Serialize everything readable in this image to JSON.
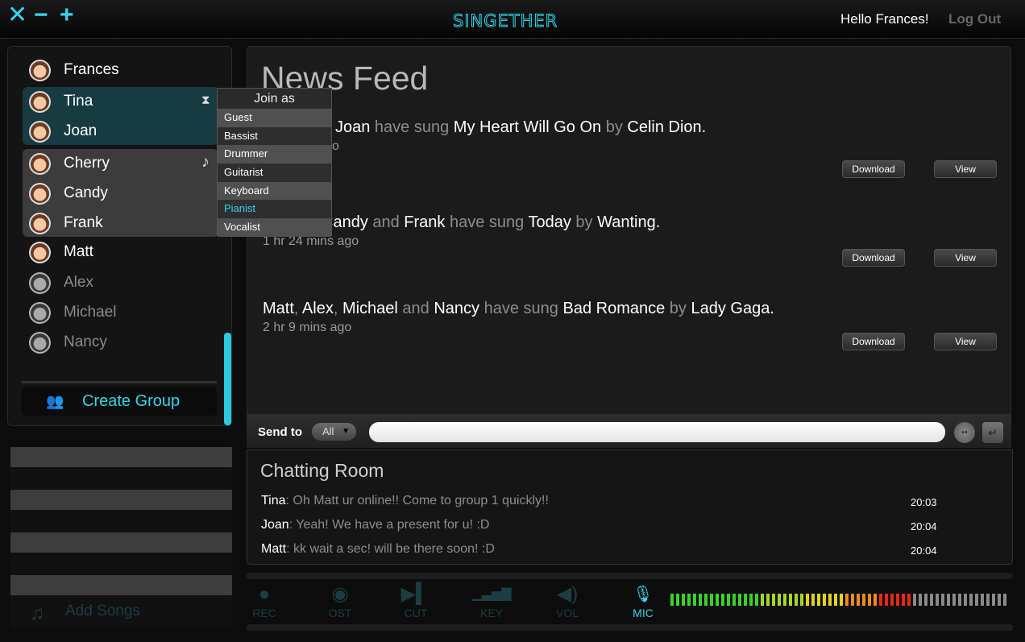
{
  "window": {
    "close_symbol": "✕",
    "minimize_symbol": "−",
    "maximize_symbol": "+",
    "logo_text": "SINGETHER",
    "greeting": "Hello Frances!",
    "logout": "Log Out",
    "accent_color": "#33d6ee"
  },
  "friends": {
    "list": [
      {
        "name": "Frances",
        "status": "online"
      },
      {
        "name": "Tina",
        "status": "online"
      },
      {
        "name": "Joan",
        "status": "online"
      },
      {
        "name": "Cherry",
        "status": "online"
      },
      {
        "name": "Candy",
        "status": "online"
      },
      {
        "name": "Frank",
        "status": "online"
      },
      {
        "name": "Matt",
        "status": "online"
      },
      {
        "name": "Alex",
        "status": "offline"
      },
      {
        "name": "Michael",
        "status": "offline"
      },
      {
        "name": "Nancy",
        "status": "offline"
      }
    ],
    "waiting_icon": "hourglass-icon",
    "singing_icon": "music-note-icon",
    "create_group": "Create Group"
  },
  "join_popup": {
    "title": "Join as",
    "options": [
      "Guest",
      "Bassist",
      "Drummer",
      "Guitarist",
      "Keyboard",
      "Pianist",
      "Vocalist"
    ],
    "highlighted": "Pianist"
  },
  "songs": {
    "add_label": "Add Songs"
  },
  "news_feed": {
    "title": "News Feed",
    "items": [
      {
        "segments": [
          {
            "t": "Joan",
            "c": "w"
          },
          {
            "t": " have sung ",
            "c": "g"
          },
          {
            "t": "My Heart Will Go On",
            "c": "w"
          },
          {
            "t": " by ",
            "c": "g"
          },
          {
            "t": "Celin Dion",
            "c": "w"
          },
          {
            "t": ".",
            "c": "w"
          }
        ],
        "time": "o",
        "download": "Download",
        "view": "View"
      },
      {
        "segments": [
          {
            "t": "Candy",
            "c": "w"
          },
          {
            "t": " and ",
            "c": "g"
          },
          {
            "t": "Frank",
            "c": "w"
          },
          {
            "t": " have sung ",
            "c": "g"
          },
          {
            "t": "Today",
            "c": "w"
          },
          {
            "t": " by ",
            "c": "g"
          },
          {
            "t": "Wanting",
            "c": "w"
          },
          {
            "t": ".",
            "c": "w"
          }
        ],
        "time": "1 hr 24 mins ago",
        "download": "Download",
        "view": "View"
      },
      {
        "segments": [
          {
            "t": "Matt",
            "c": "w"
          },
          {
            "t": ", ",
            "c": "g"
          },
          {
            "t": "Alex",
            "c": "w"
          },
          {
            "t": ", ",
            "c": "g"
          },
          {
            "t": "Michael",
            "c": "w"
          },
          {
            "t": " and ",
            "c": "g"
          },
          {
            "t": "Nancy",
            "c": "w"
          },
          {
            "t": " have sung ",
            "c": "g"
          },
          {
            "t": "Bad Romance",
            "c": "w"
          },
          {
            "t": " by ",
            "c": "g"
          },
          {
            "t": "Lady Gaga",
            "c": "w"
          },
          {
            "t": ".",
            "c": "w"
          }
        ],
        "time": "2 hr 9 mins ago",
        "download": "Download",
        "view": "View"
      }
    ]
  },
  "send_bar": {
    "label": "Send to",
    "selected": "All",
    "input_value": "",
    "emoji_icon": "emoji-icon",
    "enter_icon": "enter-icon"
  },
  "chat": {
    "title": "Chatting Room",
    "messages": [
      {
        "who": "Tina",
        "msg": ": Oh Matt ur online!! Come to group 1 quickly!!",
        "time": "20:03"
      },
      {
        "who": "Joan",
        "msg": ": Yeah! We have a present for u! :D",
        "time": "20:04"
      },
      {
        "who": "Matt",
        "msg": ": kk wait a sec! will be there soon! :D",
        "time": "20:04"
      }
    ]
  },
  "controls": {
    "buttons": [
      {
        "label": "REC",
        "icon": "record-icon",
        "active": false
      },
      {
        "label": "OST",
        "icon": "disc-icon",
        "active": false
      },
      {
        "label": "CUT",
        "icon": "skip-icon",
        "active": false
      },
      {
        "label": "KEY",
        "icon": "bars-icon",
        "active": false
      },
      {
        "label": "VOL",
        "icon": "speaker-icon",
        "active": false
      },
      {
        "label": "MIC",
        "icon": "microphone-icon",
        "active": true
      }
    ],
    "mic_level": 0.72
  }
}
